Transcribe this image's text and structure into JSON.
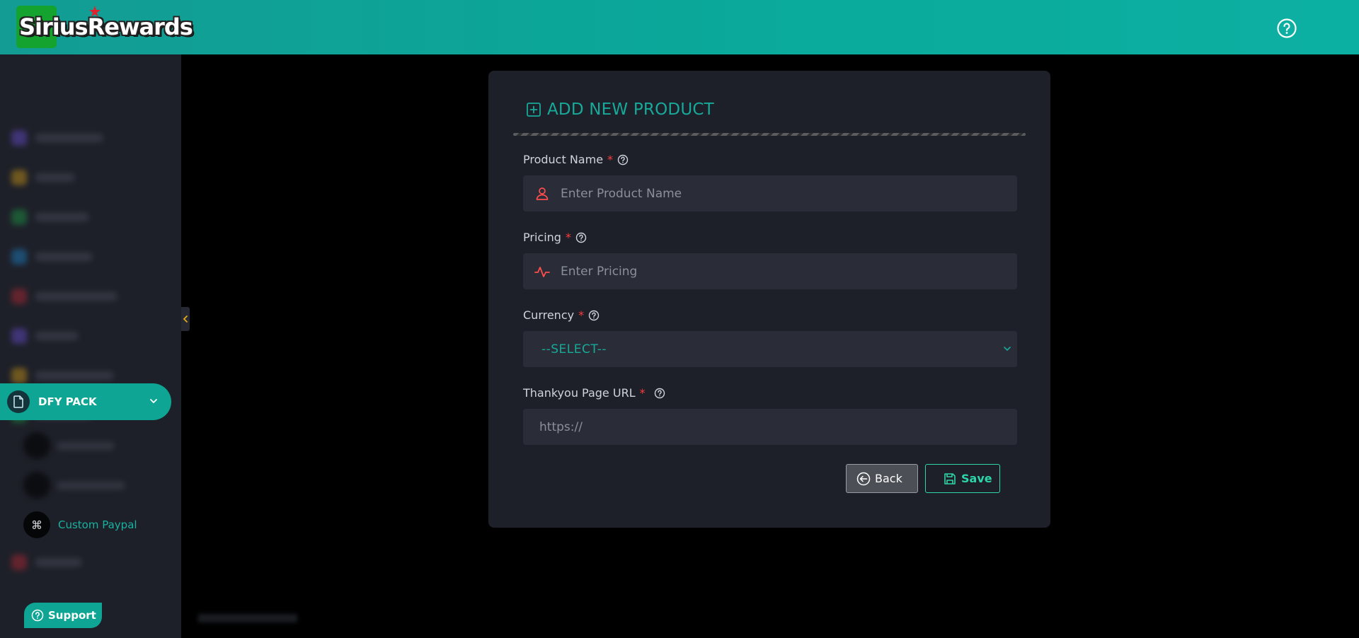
{
  "header": {
    "logo_text": "SiriusRewards",
    "help_icon": "question-circle-icon"
  },
  "sidebar": {
    "dfy_pack": {
      "label": "DFY PACK",
      "icon": "file-icon"
    },
    "sub_items": [
      {
        "label": "Custom Paypal",
        "icon": "command-icon"
      }
    ],
    "support": {
      "label": "Support",
      "icon": "question-circle-icon"
    }
  },
  "form": {
    "title": "ADD NEW PRODUCT",
    "product_name": {
      "label": "Product Name",
      "required": "*",
      "placeholder": "Enter Product Name",
      "value": ""
    },
    "pricing": {
      "label": "Pricing",
      "required": "*",
      "placeholder": "Enter Pricing",
      "value": ""
    },
    "currency": {
      "label": "Currency",
      "required": "*",
      "selected": "--SELECT--"
    },
    "thankyou_url": {
      "label": "Thankyou Page URL",
      "required": "*",
      "placeholder": "https://",
      "value": ""
    },
    "back_label": "Back",
    "save_label": "Save"
  },
  "colors": {
    "accent": "#17a99a",
    "header": "#0aa99b",
    "required": "#ff3b3b",
    "save": "#2cd6a8"
  }
}
